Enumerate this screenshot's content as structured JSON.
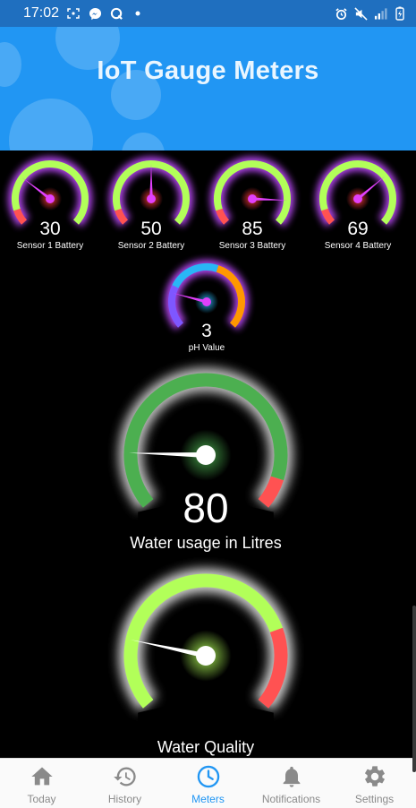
{
  "status_bar": {
    "time": "17:02",
    "left_icons": [
      "screenshot-icon",
      "messenger-icon",
      "q-app-icon",
      "dot-icon"
    ],
    "right_icons": [
      "alarm-icon",
      "mute-icon",
      "signal-icon",
      "battery-charging-icon"
    ]
  },
  "header": {
    "title": "IoT Gauge Meters"
  },
  "gauges": {
    "sensor1": {
      "label": "Sensor 1 Battery",
      "value": "30",
      "level": 30,
      "min": 0,
      "max": 100
    },
    "sensor2": {
      "label": "Sensor 2 Battery",
      "value": "50",
      "level": 50,
      "min": 0,
      "max": 100
    },
    "sensor3": {
      "label": "Sensor 3 Battery",
      "value": "85",
      "level": 85,
      "min": 0,
      "max": 100
    },
    "sensor4": {
      "label": "Sensor 4 Battery",
      "value": "69",
      "level": 69,
      "min": 0,
      "max": 100
    },
    "ph": {
      "label": "pH Value",
      "value": "3",
      "level": 3,
      "min": 0,
      "max": 14
    },
    "water_usage": {
      "label": "Water usage in Litres",
      "value": "80",
      "level": 80,
      "min": 0,
      "max": 500
    },
    "water_quality": {
      "label": "Water Quality",
      "level": 20,
      "min": 0,
      "max": 100
    }
  },
  "colors": {
    "battery_green": "#b2ff59",
    "battery_red": "#ff5252",
    "needle_battery": "#e040fb",
    "glow_battery": "#c04cff",
    "ph_blue": "#29b6f6",
    "ph_orange": "#ff9800",
    "usage_green": "#4caf50",
    "quality_green": "#b2ff59",
    "header_blue": "#2196f3",
    "nav_active": "#2196f3"
  },
  "bottom_nav": {
    "items": [
      {
        "label": "Today",
        "icon": "home-icon",
        "active": false
      },
      {
        "label": "History",
        "icon": "history-icon",
        "active": false
      },
      {
        "label": "Meters",
        "icon": "clock-icon",
        "active": true
      },
      {
        "label": "Notifications",
        "icon": "bell-icon",
        "active": false
      },
      {
        "label": "Settings",
        "icon": "gear-icon",
        "active": false
      }
    ]
  }
}
